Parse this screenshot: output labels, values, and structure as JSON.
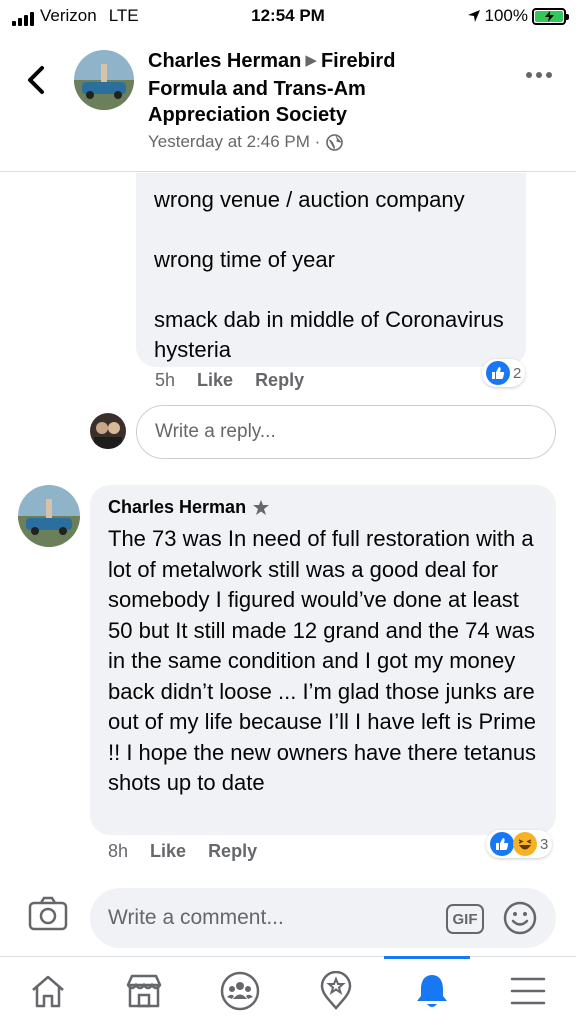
{
  "status_bar": {
    "carrier": "Verizon",
    "network": "LTE",
    "time": "12:54 PM",
    "battery_percent": "100%",
    "battery_level": 1.0
  },
  "header": {
    "author": "Charles Herman",
    "group": "Firebird Formula and Trans-Am Appreciation Society",
    "timestamp": "Yesterday at 2:46 PM ·",
    "privacy_icon": "globe-icon"
  },
  "comment_1": {
    "lines": [
      "wrong venue / auction company",
      "wrong time of year",
      "smack dab in middle of Coronavirus hysteria"
    ],
    "time": "5h",
    "like_label": "Like",
    "reply_label": "Reply",
    "reaction_count": "2",
    "reactions": [
      "like-icon"
    ]
  },
  "reply_box": {
    "placeholder": "Write a reply..."
  },
  "comment_2": {
    "author": "Charles Herman",
    "text": "The 73 was In need of full restoration with a lot of metalwork still was a good deal for somebody I figured would’ve done at least 50 but It still made 12 grand and the 74 was in the same condition and I got my money back didn’t loose ... I’m glad those junks are out of my life because I’ll I have left is Prime !! I hope the new owners have there tetanus shots up to date",
    "time": "8h",
    "like_label": "Like",
    "reply_label": "Reply",
    "reaction_count": "3",
    "reactions": [
      "like-icon",
      "haha-icon"
    ]
  },
  "composer": {
    "placeholder": "Write a comment...",
    "gif_label": "GIF"
  },
  "tabbar": {
    "tabs": [
      "home-icon",
      "marketplace-icon",
      "groups-icon",
      "pages-icon",
      "notifications-icon",
      "menu-icon"
    ],
    "active": "notifications-icon"
  },
  "colors": {
    "accent": "#1877f2",
    "bubble": "#f0f2f5",
    "secondary_text": "#65676b",
    "battery": "#34c759"
  }
}
